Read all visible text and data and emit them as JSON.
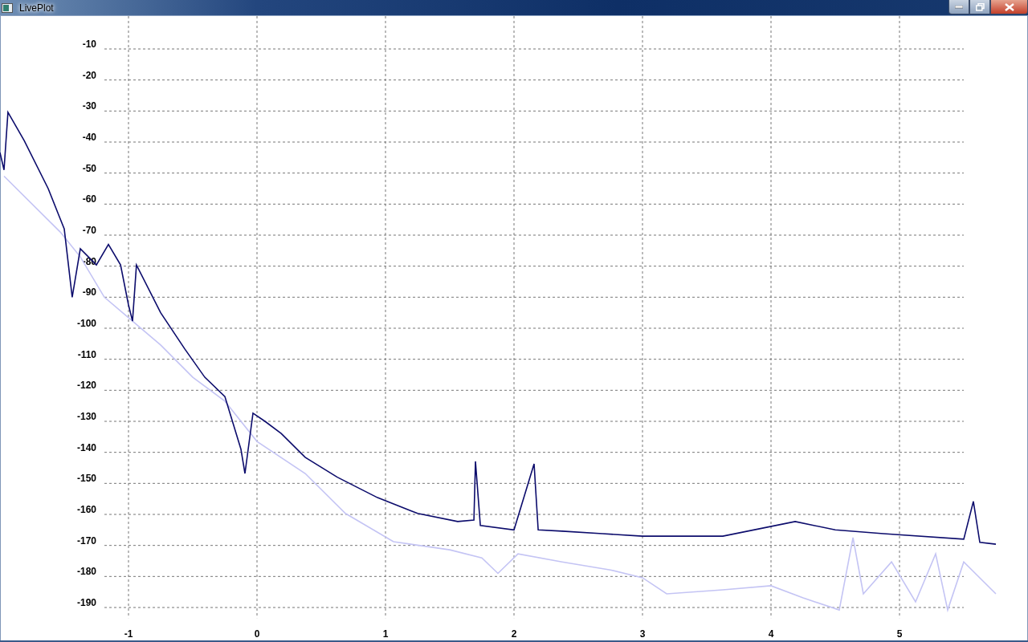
{
  "window": {
    "title": "LivePlot"
  },
  "chart": {
    "chart_data": {
      "type": "line",
      "grid": true,
      "xlim": [
        -2,
        6
      ],
      "ylim": [
        -193.4,
        0.6
      ],
      "xticks": [
        -1,
        0,
        1,
        2,
        3,
        4,
        5
      ],
      "yticks": [
        -10,
        -20,
        -30,
        -40,
        -50,
        -60,
        -70,
        -80,
        -90,
        -100,
        -110,
        -120,
        -130,
        -140,
        -150,
        -160,
        -170,
        -180,
        -190
      ],
      "series": [
        {
          "color": "#c4c4f4",
          "x": [
            -1.969,
            -1.531,
            -1.375,
            -1.188,
            -0.969,
            -0.75,
            -0.5,
            -0.25,
            0,
            0.375,
            0.688,
            1.062,
            1.5,
            1.75,
            1.875,
            2.031,
            2.375,
            2.75,
            3,
            3.188,
            3.625,
            4,
            4.25,
            4.531,
            4.638,
            4.719,
            4.938,
            5.125,
            5.281,
            5.375,
            5.5,
            5.75
          ],
          "values": [
            -51,
            -69,
            -77,
            -90,
            -97.7,
            -105.4,
            -115.8,
            -123.5,
            -136.5,
            -146.8,
            -159.7,
            -168.8,
            -171.4,
            -174,
            -179,
            -172.7,
            -175.3,
            -177.9,
            -180.4,
            -185.6,
            -184.3,
            -183,
            -186.9,
            -190.8,
            -167.5,
            -185.6,
            -175.3,
            -188.2,
            -172.7,
            -190.8,
            -175.3,
            -185.6
          ]
        },
        {
          "color": "#0c0c6c",
          "x": [
            -2,
            -1.969,
            -1.938,
            -1.812,
            -1.625,
            -1.55,
            -1.5,
            -1.438,
            -1.375,
            -1.25,
            -1.156,
            -1.062,
            -1,
            -0.969,
            -0.938,
            -0.75,
            -0.562,
            -0.406,
            -0.25,
            -0.125,
            -0.094,
            -0.031,
            0.062,
            0.188,
            0.375,
            0.625,
            0.938,
            1.25,
            1.562,
            1.688,
            1.7,
            1.738,
            2,
            2.156,
            2.188,
            2.375,
            2.688,
            3,
            3.625,
            4.188,
            4.5,
            4.875,
            5.5,
            5.575,
            5.625,
            5.75
          ],
          "values": [
            -43.4,
            -49,
            -30.4,
            -39.5,
            -55,
            -62.8,
            -68,
            -90,
            -74.4,
            -79.6,
            -73,
            -79.6,
            -92.5,
            -97.7,
            -79.6,
            -95,
            -106.7,
            -115.8,
            -122,
            -139,
            -146.8,
            -127.4,
            -130,
            -133.9,
            -141.6,
            -148,
            -154.6,
            -159.7,
            -162.3,
            -161.8,
            -142.9,
            -163.6,
            -165,
            -143.7,
            -165,
            -165.4,
            -166.2,
            -167,
            -167,
            -162.3,
            -165,
            -166.2,
            -168,
            -155.8,
            -169,
            -169.6
          ]
        }
      ]
    }
  }
}
